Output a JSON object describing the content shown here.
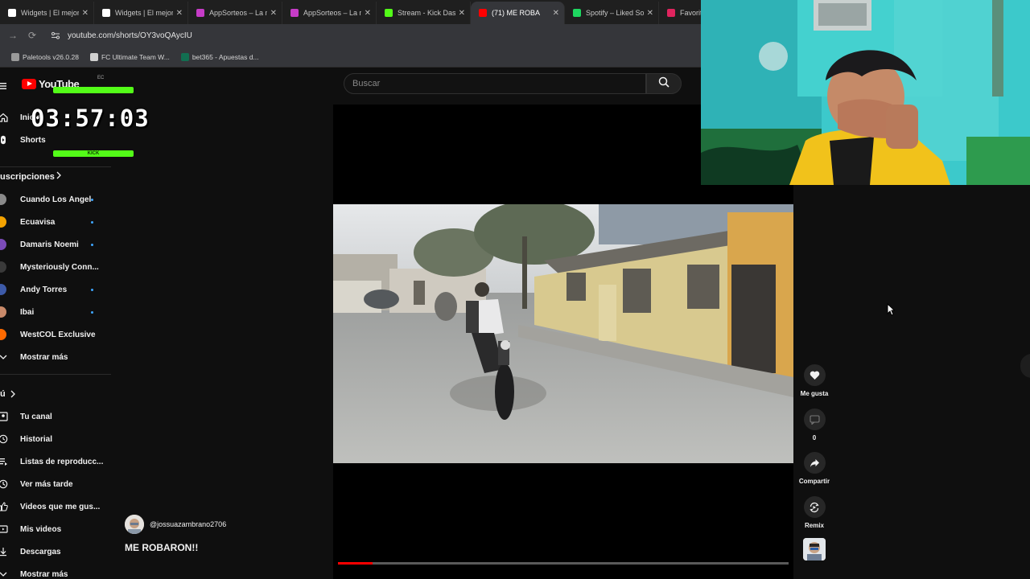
{
  "browser": {
    "tabs": [
      {
        "title": "Widgets | El mejor",
        "color": "#ffffff",
        "active": false
      },
      {
        "title": "Widgets | El mejor",
        "color": "#ffffff",
        "active": false
      },
      {
        "title": "AppSorteos – La m",
        "color": "#c63cc7",
        "active": false
      },
      {
        "title": "AppSorteos – La m",
        "color": "#c63cc7",
        "active": false
      },
      {
        "title": "Stream - Kick Das",
        "color": "#53fc18",
        "active": false
      },
      {
        "title": "(71) ME ROBA",
        "color": "#ff0000",
        "active": true
      },
      {
        "title": "Spotify – Liked So",
        "color": "#1ed760",
        "active": false
      },
      {
        "title": "Favoritos",
        "color": "#e0245e",
        "active": false
      }
    ],
    "url": "youtube.com/shorts/OY3voQAycIU",
    "bookmarks": [
      {
        "label": "Paletools v26.0.28",
        "color": "#9a9a9a"
      },
      {
        "label": "FC Ultimate Team W...",
        "color": "#d0d0d0"
      },
      {
        "label": "bet365 - Apuestas d...",
        "color": "#126e51"
      }
    ]
  },
  "youtube": {
    "logo_word": "YouTube",
    "country": "EC",
    "nav_home": "Inicio",
    "nav_shorts": "Shorts",
    "subscriptions_title": "uscripciones",
    "subscriptions": [
      {
        "label": "Cuando Los Ángeles...",
        "color": "#8a8a8a"
      },
      {
        "label": "Ecuavisa",
        "color": "#f2a200"
      },
      {
        "label": "Damaris Noemi",
        "color": "#7b4bb8"
      },
      {
        "label": "Mysteriously Conn...",
        "color": "#3a3a3a"
      },
      {
        "label": "Andy Torres",
        "color": "#3d5aa8"
      },
      {
        "label": "Ibai",
        "color": "#c98a6a"
      },
      {
        "label": "WestCOL Exclusive",
        "color": "#ff6a00"
      }
    ],
    "show_more_subs": "Mostrar más",
    "you_title": "ú",
    "you_items": [
      {
        "label": "Tu canal",
        "icon": "channel-icon"
      },
      {
        "label": "Historial",
        "icon": "history-icon"
      },
      {
        "label": "Listas de reproducc...",
        "icon": "playlists-icon"
      },
      {
        "label": "Ver más tarde",
        "icon": "watch-later-icon"
      },
      {
        "label": "Videos que me gus...",
        "icon": "liked-icon"
      },
      {
        "label": "Mis videos",
        "icon": "my-videos-icon"
      },
      {
        "label": "Descargas",
        "icon": "downloads-icon"
      }
    ],
    "show_more_you": "Mostrar más",
    "search_placeholder": "Buscar",
    "short": {
      "channel_handle": "@jossuazambrano2706",
      "title": "ME ROBARON!!",
      "progress": 0.077,
      "actions": {
        "like": "Me gusta",
        "comments": "0",
        "share": "Compartir",
        "remix": "Remix"
      }
    }
  },
  "overlay": {
    "timer": "03:57:03",
    "timer_badge": "KICK",
    "accent": "#53fc18"
  }
}
